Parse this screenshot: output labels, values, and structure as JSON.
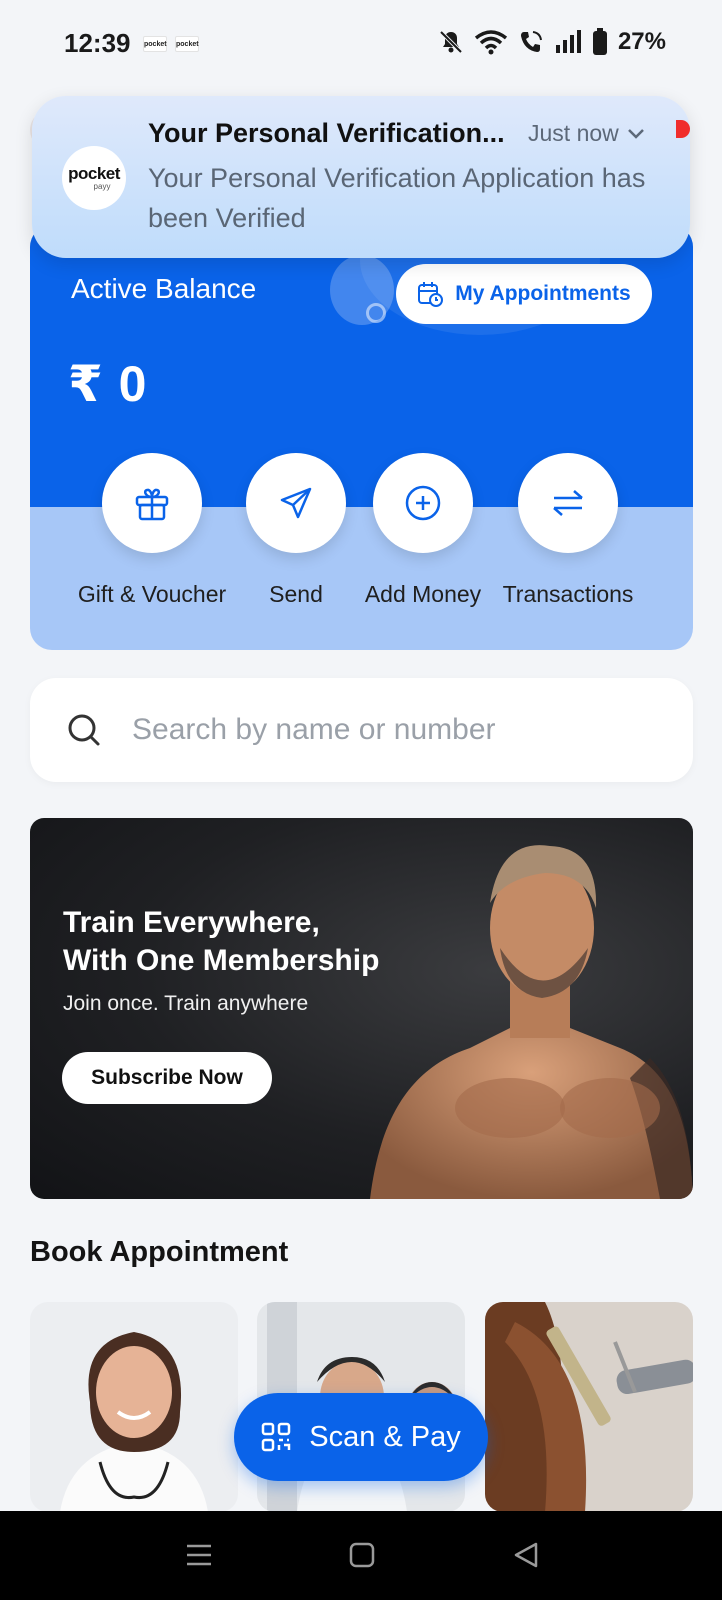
{
  "status_bar": {
    "time": "12:39",
    "mini_logo_text": "pocket",
    "battery": "27%"
  },
  "notification": {
    "app_logo_line1": "pocket",
    "app_logo_line2": "payy",
    "title": "Your Personal Verification...",
    "time": "Just now",
    "body": "Your Personal Verification Application has been Verified"
  },
  "balance_card": {
    "label": "Active Balance",
    "value": "₹ 0",
    "appointments_button": "My Appointments",
    "actions": [
      {
        "label": "Gift & Voucher",
        "icon": "gift-icon"
      },
      {
        "label": "Send",
        "icon": "send-icon"
      },
      {
        "label": "Add Money",
        "icon": "plus-circle-icon"
      },
      {
        "label": "Transactions",
        "icon": "transfer-arrows-icon"
      }
    ]
  },
  "search": {
    "placeholder": "Search by name or number"
  },
  "banner": {
    "title_line1": "Train Everywhere,",
    "title_line2": "With One Membership",
    "subtitle": "Join once. Train anywhere",
    "cta": "Subscribe Now"
  },
  "book_appointment": {
    "title": "Book Appointment",
    "cards": [
      "doctor",
      "lab",
      "salon"
    ]
  },
  "fab": {
    "label": "Scan & Pay",
    "icon": "qr-scan-icon"
  },
  "colors": {
    "primary": "#0a63e9",
    "card_light": "#a7c7f7",
    "background": "#f3f5f8"
  }
}
